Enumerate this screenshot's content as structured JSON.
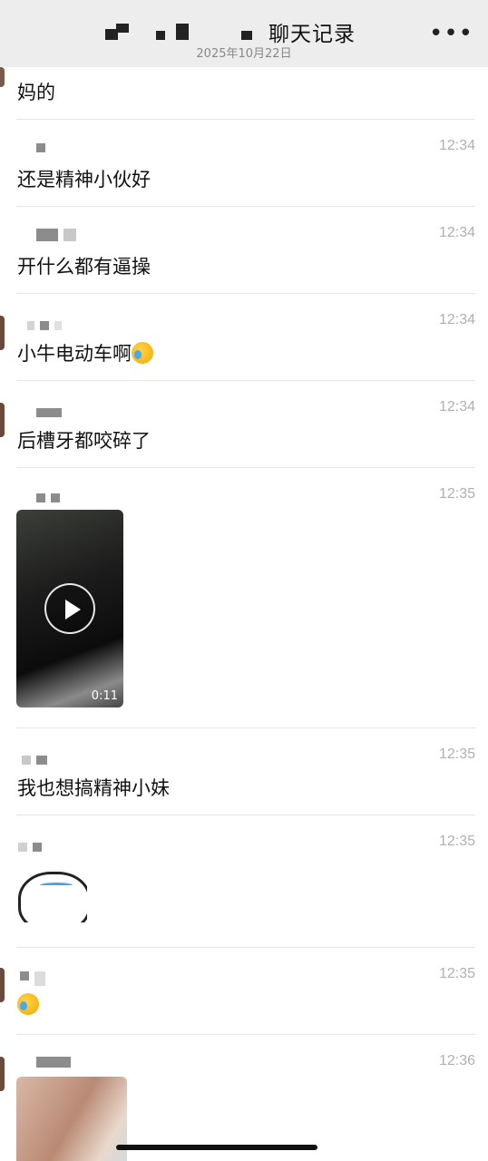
{
  "header": {
    "title_suffix": "聊天记录",
    "date": "2025年10月22日",
    "more_label": "•••"
  },
  "messages": [
    {
      "time": "",
      "text": "妈的"
    },
    {
      "time": "12:34",
      "text": "还是精神小伙好"
    },
    {
      "time": "12:34",
      "text": "开什么都有逼操"
    },
    {
      "time": "12:34",
      "text": "小牛电动车啊"
    },
    {
      "time": "12:34",
      "text": "后槽牙都咬碎了"
    },
    {
      "time": "12:35",
      "video_duration": "0:11"
    },
    {
      "time": "12:35",
      "text": "我也想搞精神小妹"
    },
    {
      "time": "12:35",
      "sticker": "crying-face-sticker"
    },
    {
      "time": "12:35",
      "emoji": "laughing-crying-emoji"
    },
    {
      "time": "12:36",
      "image": "blurred-photo"
    }
  ],
  "colors": {
    "header_bg": "#ededed",
    "time": "#b0b0b0",
    "separator": "#e6e6e6"
  }
}
